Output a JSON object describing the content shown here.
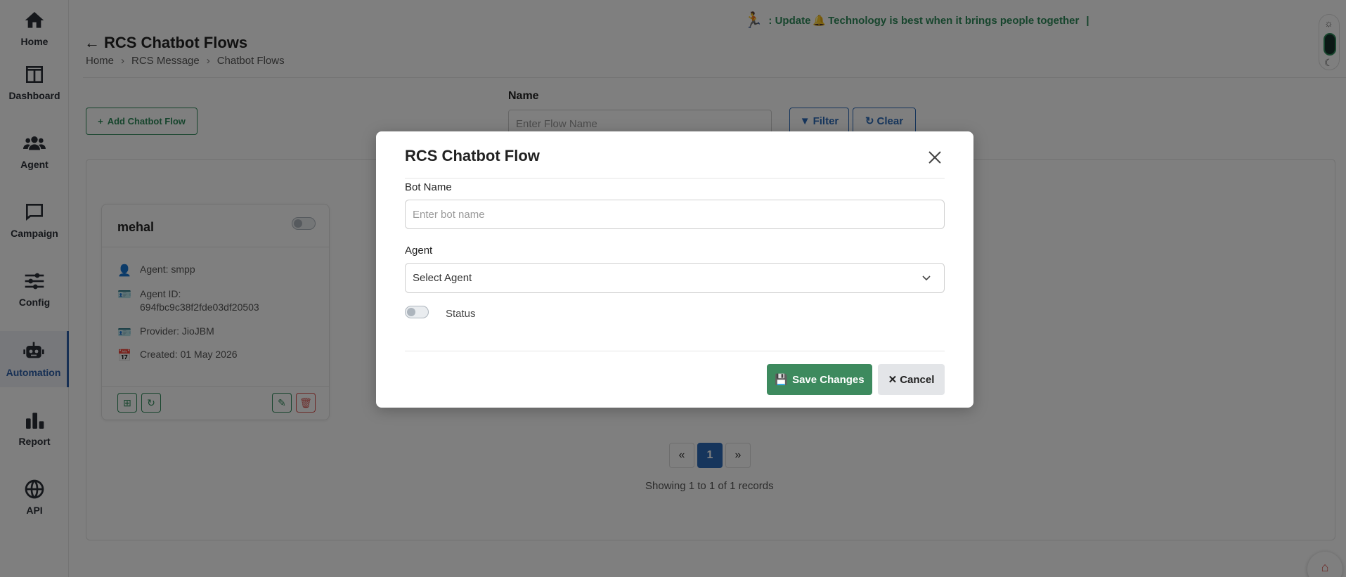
{
  "nav": {
    "items": [
      {
        "label": "Home",
        "icon": "home-icon"
      },
      {
        "label": "Dashboard",
        "icon": "dashboard-icon"
      },
      {
        "label": "Agent",
        "icon": "users-icon"
      },
      {
        "label": "Campaign",
        "icon": "chat-icon"
      },
      {
        "label": "Config",
        "icon": "sliders-icon"
      },
      {
        "label": "Automation",
        "icon": "robot-icon"
      },
      {
        "label": "Report",
        "icon": "bar-chart-icon"
      },
      {
        "label": "API",
        "icon": "globe-icon"
      }
    ],
    "active": "Automation"
  },
  "marquee": {
    "prefix": ": Update",
    "text": "Technology is best when it brings people together",
    "separator": "|"
  },
  "header": {
    "title": "RCS Chatbot Flows",
    "breadcrumb": [
      "Home",
      "RCS Message",
      "Chatbot Flows"
    ]
  },
  "toolbar": {
    "add_label": "Add Chatbot Flow",
    "name_label": "Name",
    "name_placeholder": "Enter Flow Name",
    "filter_label": "Filter",
    "clear_label": "Clear"
  },
  "card": {
    "name": "mehal",
    "agent": "Agent: smpp",
    "agent_id_label": "Agent ID:",
    "agent_id": "694fbc9c38f2fde03df20503",
    "provider": "Provider: JioJBM",
    "created": "Created: 01 May 2026"
  },
  "pagination": {
    "prev": "«",
    "current": "1",
    "next": "»",
    "info": "Showing 1 to 1 of 1 records"
  },
  "modal": {
    "title": "RCS Chatbot Flow",
    "bot_name_label": "Bot Name",
    "bot_name_placeholder": "Enter bot name",
    "agent_label": "Agent",
    "agent_selected": "Select Agent",
    "status_label": "Status",
    "save_label": "Save Changes",
    "cancel_label": "Cancel"
  },
  "colors": {
    "accent_green": "#3d8a5e",
    "accent_blue": "#2c6bb8",
    "danger": "#d9534f"
  }
}
